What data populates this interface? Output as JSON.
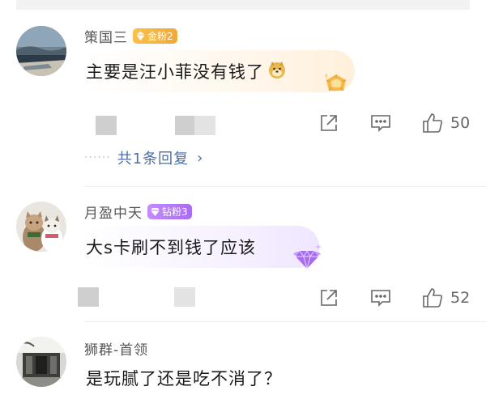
{
  "comments": [
    {
      "username": "策国三",
      "badge": {
        "text": "金粉2",
        "type": "gold",
        "color": "#f4b441"
      },
      "text": "主要是汪小菲没有钱了",
      "emoji": "doge-emoji",
      "likes": "50",
      "reply": {
        "text": "共1条回复",
        "dots": "······",
        "chevron": "›"
      }
    },
    {
      "username": "月盈中天",
      "badge": {
        "text": "钻粉3",
        "type": "diamond",
        "color": "#b57cf5"
      },
      "text": "大s卡刷不到钱了应该",
      "likes": "52"
    },
    {
      "username": "狮群-首领",
      "text": "是玩腻了还是吃不消了？"
    }
  ],
  "colors": {
    "link": "#4a6ea8",
    "text": "#1a1a1a",
    "meta": "#555555",
    "icon": "#666666"
  }
}
